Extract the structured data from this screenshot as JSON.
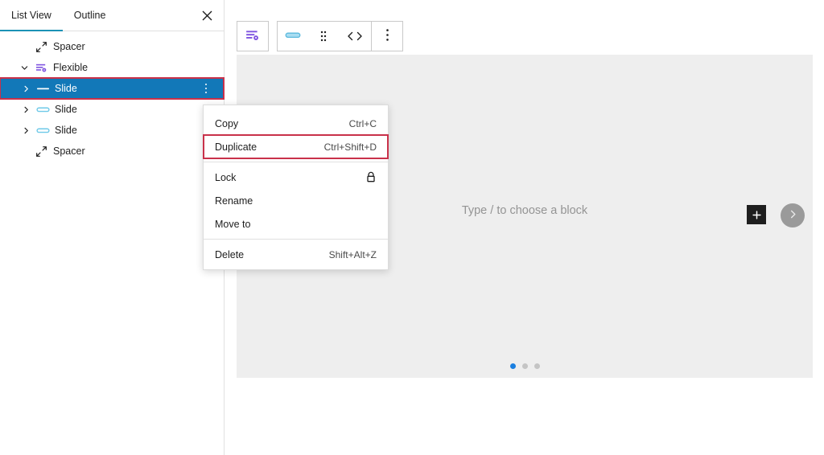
{
  "sidebar": {
    "tabs": [
      {
        "label": "List View",
        "active": true,
        "name": "tab-list-view"
      },
      {
        "label": "Outline",
        "active": false,
        "name": "tab-outline"
      }
    ],
    "close_label": "✕",
    "tree": [
      {
        "label": "Spacer",
        "icon": "spacer-icon",
        "level": 0,
        "chevron": "",
        "selected": false
      },
      {
        "label": "Flexible",
        "icon": "flexible-icon",
        "level": 0,
        "chevron": "⌄",
        "selected": false
      },
      {
        "label": "Slide",
        "icon": "slide-icon-selected",
        "level": 1,
        "chevron": "›",
        "selected": true,
        "ellipsis": true
      },
      {
        "label": "Slide",
        "icon": "slide-icon",
        "level": 1,
        "chevron": "›",
        "selected": false
      },
      {
        "label": "Slide",
        "icon": "slide-icon",
        "level": 1,
        "chevron": "›",
        "selected": false
      },
      {
        "label": "Spacer",
        "icon": "spacer-icon",
        "level": 0,
        "chevron": "",
        "selected": false
      }
    ]
  },
  "toolbar": {
    "parent_block_icon": "flexible-icon",
    "block_type_icon": "slide-icon",
    "drag_icon": "drag-handle-icon",
    "prev_icon": "chevron-left-icon",
    "next_icon": "chevron-right-icon",
    "options_icon": "vertical-ellipsis-icon"
  },
  "canvas": {
    "placeholder": "Type / to choose a block",
    "add_block_label": "+",
    "next_slide_icon": "chevron-right-icon",
    "pagination": [
      {
        "active": true
      },
      {
        "active": false
      },
      {
        "active": false
      }
    ]
  },
  "context_menu": {
    "groups": [
      {
        "items": [
          {
            "label": "Copy",
            "shortcut": "Ctrl+C",
            "highlighted": false,
            "name": "menu-item-copy"
          },
          {
            "label": "Duplicate",
            "shortcut": "Ctrl+Shift+D",
            "highlighted": true,
            "name": "menu-item-duplicate"
          }
        ]
      },
      {
        "items": [
          {
            "label": "Lock",
            "shortcut": "",
            "icon": "lock-icon",
            "highlighted": false,
            "name": "menu-item-lock"
          },
          {
            "label": "Rename",
            "shortcut": "",
            "highlighted": false,
            "name": "menu-item-rename"
          },
          {
            "label": "Move to",
            "shortcut": "",
            "highlighted": false,
            "name": "menu-item-move-to"
          }
        ]
      },
      {
        "items": [
          {
            "label": "Delete",
            "shortcut": "Shift+Alt+Z",
            "highlighted": false,
            "name": "menu-item-delete"
          }
        ]
      }
    ]
  },
  "colors": {
    "selection_blue": "#1278b8",
    "highlight_red": "#c9314a",
    "accent_purple": "#7f54e0",
    "slide_blue": "#6ec9e8",
    "active_dot": "#1b7fe0",
    "tab_underline": "#1b92b5",
    "canvas_bg": "#eeeeee"
  }
}
